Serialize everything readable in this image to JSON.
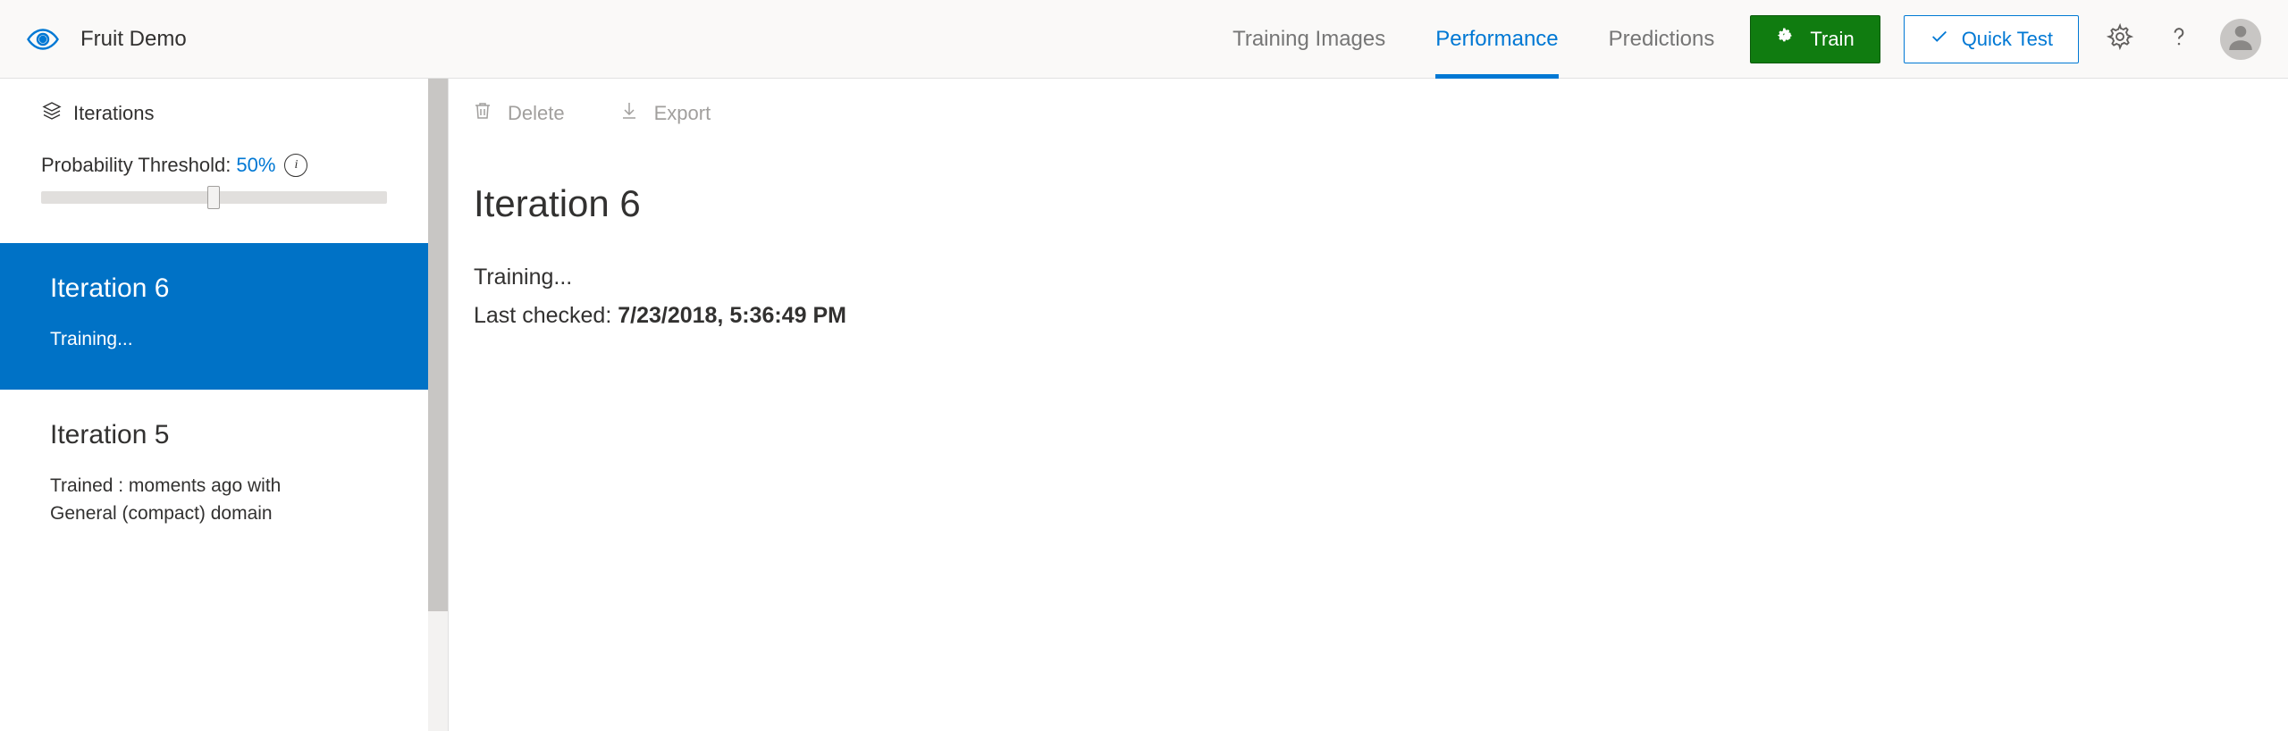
{
  "header": {
    "project_name": "Fruit Demo",
    "tabs": [
      {
        "label": "Training Images",
        "active": false
      },
      {
        "label": "Performance",
        "active": true
      },
      {
        "label": "Predictions",
        "active": false
      }
    ],
    "train_label": "Train",
    "quicktest_label": "Quick Test"
  },
  "sidebar": {
    "heading": "Iterations",
    "threshold_label": "Probability Threshold:",
    "threshold_value": "50%",
    "iterations": [
      {
        "title": "Iteration 6",
        "subtitle": "Training...",
        "selected": true
      },
      {
        "title": "Iteration 5",
        "subtitle": "Trained : moments ago with General (compact) domain",
        "selected": false
      }
    ]
  },
  "toolbar": {
    "delete_label": "Delete",
    "export_label": "Export"
  },
  "detail": {
    "title": "Iteration 6",
    "status": "Training...",
    "last_checked_label": "Last checked: ",
    "last_checked_value": "7/23/2018, 5:36:49 PM"
  }
}
